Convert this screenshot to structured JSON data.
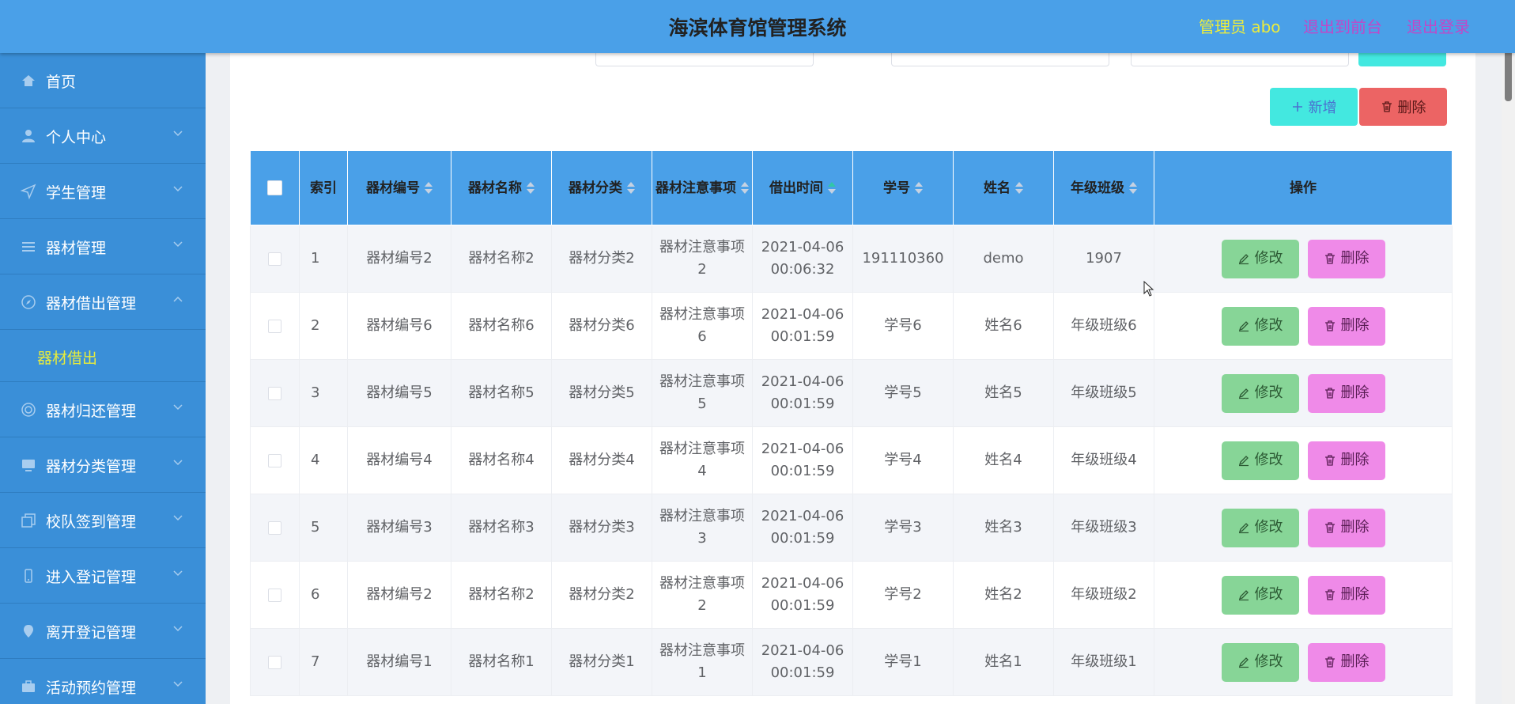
{
  "header": {
    "title": "海滨体育馆管理系统",
    "admin_label": "管理员 abo",
    "front_link": "退出到前台",
    "logout_link": "退出登录"
  },
  "sidebar": {
    "items": [
      {
        "label": "首页",
        "icon": "home-icon"
      },
      {
        "label": "个人中心",
        "icon": "user-icon"
      },
      {
        "label": "学生管理",
        "icon": "send-icon"
      },
      {
        "label": "器材管理",
        "icon": "list-icon"
      },
      {
        "label": "器材借出管理",
        "icon": "compass-icon"
      },
      {
        "label": "器材归还管理",
        "icon": "target-icon"
      },
      {
        "label": "器材分类管理",
        "icon": "monitor-icon"
      },
      {
        "label": "校队签到管理",
        "icon": "copy-icon"
      },
      {
        "label": "进入登记管理",
        "icon": "mobile-icon"
      },
      {
        "label": "离开登记管理",
        "icon": "location-icon"
      },
      {
        "label": "活动预约管理",
        "icon": "briefcase-icon"
      }
    ],
    "submenu_active": "器材借出"
  },
  "toolbar": {
    "add_label": "新增",
    "delete_label": "删除"
  },
  "table": {
    "columns": {
      "index": "索引",
      "code": "器材编号",
      "name": "器材名称",
      "category": "器材分类",
      "notes": "器材注意事项",
      "time": "借出时间",
      "student_id": "学号",
      "student_name": "姓名",
      "grade": "年级班级",
      "ops": "操作"
    },
    "rows": [
      {
        "index": "1",
        "code": "器材编号2",
        "name": "器材名称2",
        "category": "器材分类2",
        "notes": "器材注意事项2",
        "date": "2021-04-06",
        "time": "00:06:32",
        "student_id": "191110360",
        "student_name": "demo",
        "grade": "1907"
      },
      {
        "index": "2",
        "code": "器材编号6",
        "name": "器材名称6",
        "category": "器材分类6",
        "notes": "器材注意事项6",
        "date": "2021-04-06",
        "time": "00:01:59",
        "student_id": "学号6",
        "student_name": "姓名6",
        "grade": "年级班级6"
      },
      {
        "index": "3",
        "code": "器材编号5",
        "name": "器材名称5",
        "category": "器材分类5",
        "notes": "器材注意事项5",
        "date": "2021-04-06",
        "time": "00:01:59",
        "student_id": "学号5",
        "student_name": "姓名5",
        "grade": "年级班级5"
      },
      {
        "index": "4",
        "code": "器材编号4",
        "name": "器材名称4",
        "category": "器材分类4",
        "notes": "器材注意事项4",
        "date": "2021-04-06",
        "time": "00:01:59",
        "student_id": "学号4",
        "student_name": "姓名4",
        "grade": "年级班级4"
      },
      {
        "index": "5",
        "code": "器材编号3",
        "name": "器材名称3",
        "category": "器材分类3",
        "notes": "器材注意事项3",
        "date": "2021-04-06",
        "time": "00:01:59",
        "student_id": "学号3",
        "student_name": "姓名3",
        "grade": "年级班级3"
      },
      {
        "index": "6",
        "code": "器材编号2",
        "name": "器材名称2",
        "category": "器材分类2",
        "notes": "器材注意事项2",
        "date": "2021-04-06",
        "time": "00:01:59",
        "student_id": "学号2",
        "student_name": "姓名2",
        "grade": "年级班级2"
      },
      {
        "index": "7",
        "code": "器材编号1",
        "name": "器材名称1",
        "category": "器材分类1",
        "notes": "器材注意事项1",
        "date": "2021-04-06",
        "time": "00:01:59",
        "student_id": "学号1",
        "student_name": "姓名1",
        "grade": "年级班级1"
      }
    ],
    "row_actions": {
      "edit_label": "修改",
      "delete_label": "删除"
    }
  },
  "colors": {
    "header_bg": "#4aa0e8",
    "sidebar_bg": "#3a8fd8",
    "admin_text": "#ecec3c",
    "link_text": "#c048c8",
    "add_button": "#43e8e0",
    "delete_button": "#ec6464",
    "edit_row_button": "#87d597",
    "delete_row_button": "#ef8ae8"
  }
}
